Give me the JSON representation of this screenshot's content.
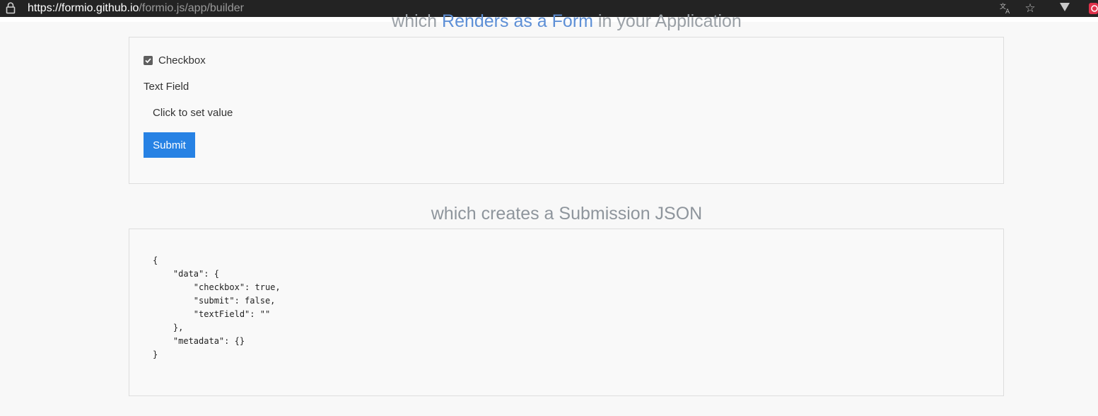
{
  "browser": {
    "url_host": "https://formio.github.io",
    "url_path": "/formio.js/app/builder",
    "icons": [
      "lock-icon",
      "translate-icon",
      "star-icon",
      "vivaldi-icon",
      "extension-badge-icon"
    ]
  },
  "headline_top": {
    "prefix": "which ",
    "accent": "Renders as a Form",
    "suffix": " in your Application"
  },
  "form": {
    "checkbox_label": "Checkbox",
    "checkbox_checked": true,
    "text_field_label": "Text Field",
    "text_field_value": "Click to set value",
    "submit_label": "Submit"
  },
  "headline_json": "which creates a Submission JSON",
  "submission_json": "{\n    \"data\": {\n        \"checkbox\": true,\n        \"submit\": false,\n        \"textField\": \"\"\n    },\n    \"metadata\": {}\n}",
  "colors": {
    "address_bar_bg": "#232323",
    "accent_link": "#5d8fd6",
    "submit_bg": "#2782e4",
    "page_bg": "#f8f8f8"
  }
}
